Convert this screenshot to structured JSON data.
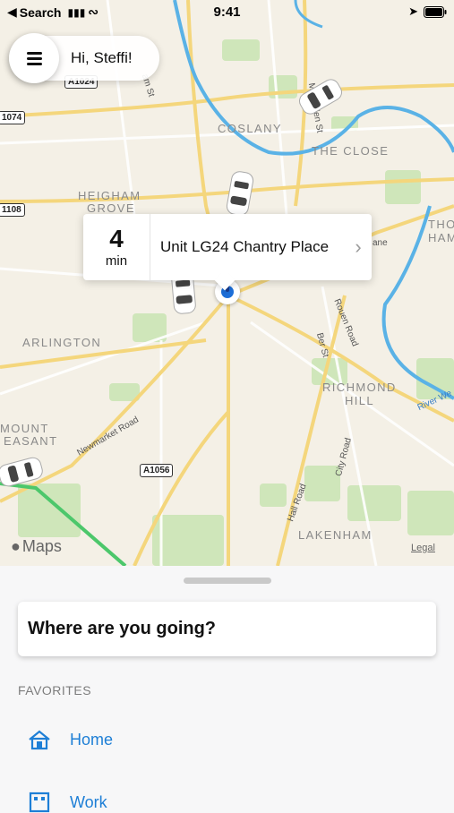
{
  "status_bar": {
    "back_label": "Search",
    "time": "9:41"
  },
  "header": {
    "greeting": "Hi, Steffi!"
  },
  "pickup_card": {
    "eta_value": "4",
    "eta_unit": "min",
    "place": "Unit LG24 Chantry Place"
  },
  "map": {
    "districts": [
      "COSLANY",
      "THE CLOSE",
      "HEIGHAM",
      "GROVE",
      "ARLINGTON",
      "RICHMOND",
      "HILL",
      "MOUNT",
      "EASANT",
      "LAKENHAM",
      "THO",
      "HAM"
    ],
    "roads": [
      "Magdalen St",
      "Ber St",
      "Rouen Road",
      "City Road",
      "Hall Road",
      "Newmarket Road",
      "River We",
      "ane",
      "am St"
    ],
    "shields": [
      "A1024",
      "1074",
      "1108",
      "A1056"
    ],
    "attribution": "Maps",
    "legal": "Legal"
  },
  "bottom_sheet": {
    "search_prompt": "Where are you going?",
    "favorites_title": "FAVORITES",
    "favorites": [
      {
        "label": "Home",
        "icon": "home-icon"
      },
      {
        "label": "Work",
        "icon": "work-icon"
      }
    ]
  },
  "colors": {
    "accent": "#1e7fd6",
    "map_bg": "#f4f0e6",
    "road": "#f5d77a",
    "water": "#5ab2e6",
    "park": "#c9e3b3"
  }
}
